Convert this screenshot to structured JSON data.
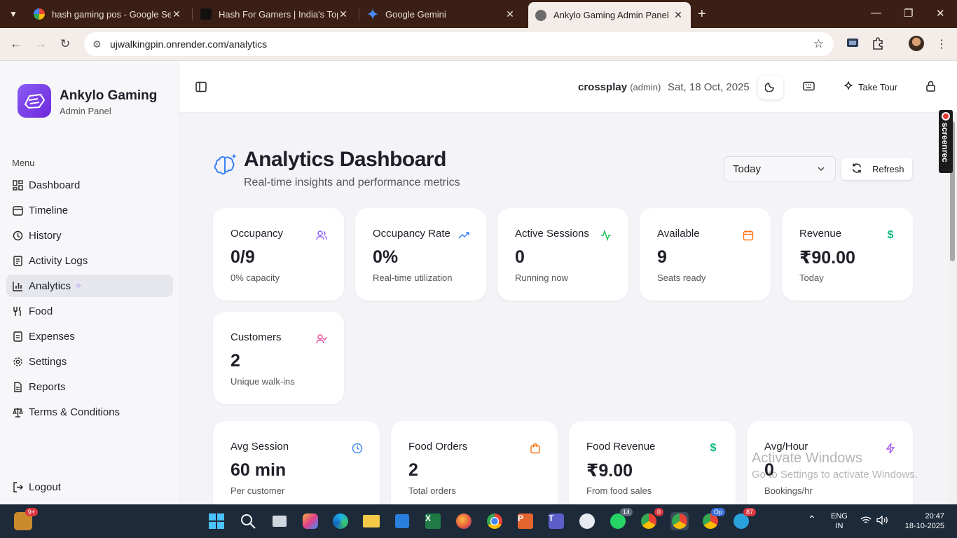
{
  "browser": {
    "tabs": [
      {
        "title": "hash gaming pos - Google Sear",
        "active": false
      },
      {
        "title": "Hash For Gamers | India's Top G",
        "active": false
      },
      {
        "title": "Google Gemini",
        "active": false
      },
      {
        "title": "Ankylo Gaming Admin Panel",
        "active": true
      }
    ],
    "url": "ujwalkingpin.onrender.com/analytics"
  },
  "sidebar": {
    "brand_name": "Ankylo Gaming",
    "brand_sub": "Admin Panel",
    "menu_label": "Menu",
    "items": [
      {
        "label": "Dashboard",
        "icon": "grid-icon"
      },
      {
        "label": "Timeline",
        "icon": "calendar-icon"
      },
      {
        "label": "History",
        "icon": "history-icon"
      },
      {
        "label": "Activity Logs",
        "icon": "list-icon"
      },
      {
        "label": "Analytics",
        "icon": "bar-chart-icon",
        "active": true
      },
      {
        "label": "Food",
        "icon": "utensils-icon"
      },
      {
        "label": "Expenses",
        "icon": "receipt-icon"
      },
      {
        "label": "Settings",
        "icon": "gear-icon"
      },
      {
        "label": "Reports",
        "icon": "file-icon"
      },
      {
        "label": "Terms & Conditions",
        "icon": "scale-icon"
      }
    ],
    "logout_label": "Logout"
  },
  "header": {
    "username": "crossplay",
    "role": "(admin)",
    "date": "Sat, 18 Oct, 2025",
    "tour_label": "Take Tour"
  },
  "main": {
    "title": "Analytics Dashboard",
    "subtitle": "Real-time insights and performance metrics",
    "period": "Today",
    "refresh_label": "Refresh",
    "cards": [
      {
        "title": "Occupancy",
        "value": "0/9",
        "sub": "0% capacity",
        "color": "#8b5cf6"
      },
      {
        "title": "Occupancy Rate",
        "value": "0%",
        "sub": "Real-time utilization",
        "color": "#3b82f6"
      },
      {
        "title": "Active Sessions",
        "value": "0",
        "sub": "Running now",
        "color": "#22c55e"
      },
      {
        "title": "Available",
        "value": "9",
        "sub": "Seats ready",
        "color": "#f97316"
      },
      {
        "title": "Revenue",
        "value": "₹90.00",
        "sub": "Today",
        "color": "#10b981"
      },
      {
        "title": "Customers",
        "value": "2",
        "sub": "Unique walk-ins",
        "color": "#ec4899"
      },
      {
        "title": "Avg Session",
        "value": "60 min",
        "sub": "Per customer",
        "color": "#3b82f6"
      },
      {
        "title": "Food Orders",
        "value": "2",
        "sub": "Total orders",
        "color": "#f97316"
      },
      {
        "title": "Food Revenue",
        "value": "₹9.00",
        "sub": "From food sales",
        "color": "#10b981"
      },
      {
        "title": "Avg/Hour",
        "value": "0",
        "sub": "Bookings/hr",
        "color": "#a855f7"
      }
    ]
  },
  "overlay": {
    "watermark_title": "Activate Windows",
    "watermark_sub": "Go to Settings to activate Windows.",
    "screenrec": "screenrec"
  },
  "taskbar": {
    "widgets_badge": "9+",
    "whatsapp_badge": "14",
    "chrome_badge": "0",
    "chrome2_badge": "Op",
    "telegram_badge": "87",
    "lang": "ENG",
    "region": "IN",
    "time": "20:47",
    "date": "18-10-2025"
  }
}
